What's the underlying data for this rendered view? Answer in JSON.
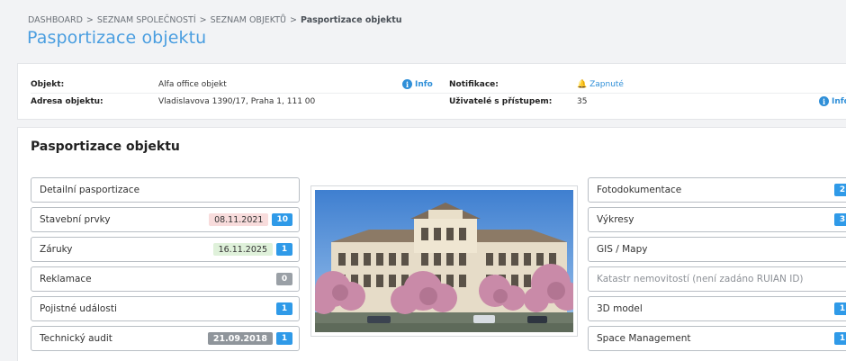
{
  "breadcrumb": {
    "items": [
      "DASHBOARD",
      "SEZNAM SPOLEČNOSTÍ",
      "SEZNAM OBJEKTŮ"
    ],
    "current": "Pasportizace objektu",
    "separator": ">"
  },
  "page_title": "Pasportizace objektu",
  "info": {
    "object_label": "Objekt:",
    "object_value": "Alfa office objekt",
    "object_info": "Info",
    "address_label": "Adresa objektu:",
    "address_value": "Vladislavova 1390/17, Praha 1, 111 00",
    "notifications_label": "Notifikace:",
    "notifications_value": "Zapnuté",
    "users_label": "Uživatelé s přístupem:",
    "users_value": "35",
    "users_info": "Info"
  },
  "section_title": "Pasportizace objektu",
  "left_buttons": [
    {
      "label": "Detailní pasportizace",
      "date": "",
      "badge": ""
    },
    {
      "label": "Stavební prvky",
      "date": "08.11.2021",
      "badge": "10"
    },
    {
      "label": "Záruky",
      "date": "16.11.2025",
      "badge": "1"
    },
    {
      "label": "Reklamace",
      "date": "",
      "badge": "0"
    },
    {
      "label": "Pojistné události",
      "date": "",
      "badge": "1"
    },
    {
      "label": "Technický audit",
      "date": "21.09.2018",
      "badge": "1"
    }
  ],
  "right_buttons": [
    {
      "label": "Fotodokumentace",
      "badge": "2"
    },
    {
      "label": "Výkresy",
      "badge": "3"
    },
    {
      "label": "GIS / Mapy",
      "badge": ""
    },
    {
      "label": "Katastr nemovitostí (není zadáno RUIAN ID)",
      "badge": ""
    },
    {
      "label": "3D model",
      "badge": "1"
    },
    {
      "label": "Space Management",
      "badge": "1"
    }
  ],
  "icons": {
    "info": "info-circle-icon",
    "bell": "bell-icon",
    "chevron": "chevron-right-icon"
  },
  "colors": {
    "accent": "#2f9ae8",
    "title": "#4a9ee0",
    "date_red": "#f8dcdc",
    "date_green": "#dff1da",
    "badge_grey": "#9aa0a6"
  }
}
